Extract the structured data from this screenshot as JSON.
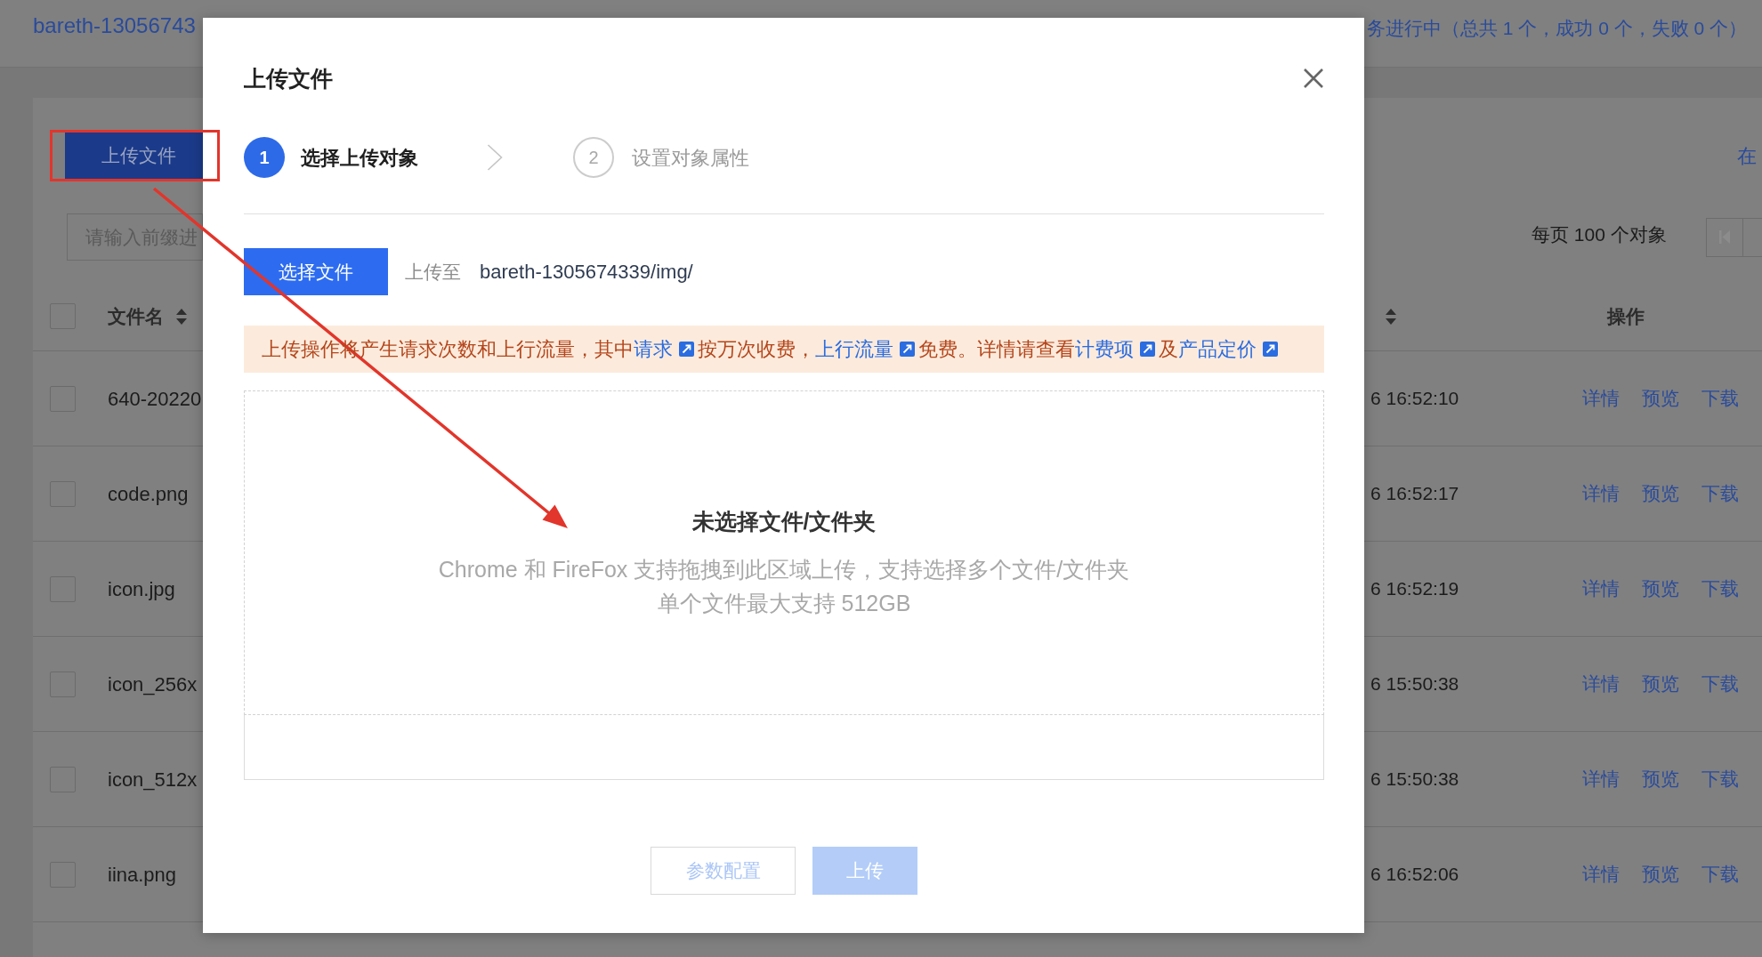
{
  "bucket_page": {
    "title": "bareth-13056743",
    "task_status": "务进行中（总共 1 个，成功 0 个，失败 0 个）",
    "upload_button": "上传文件",
    "link": "在",
    "search": {
      "placeholder": "请输入前缀进"
    },
    "page_size": "每页 100 个对象",
    "table": {
      "select_all": {
        "checked": false
      },
      "columns": [
        {
          "label": "文件名",
          "sortable": true
        },
        {
          "sortable": true
        },
        {
          "label": "操作",
          "sortable": false
        }
      ],
      "rows": [
        {
          "checked": false,
          "name": "640-20220",
          "modified": "6 16:52:10",
          "actions": [
            "详情",
            "预览",
            "下载"
          ]
        },
        {
          "checked": false,
          "name": "code.png",
          "modified": "6 16:52:17",
          "actions": [
            "详情",
            "预览",
            "下载"
          ]
        },
        {
          "checked": false,
          "name": "icon.jpg",
          "modified": "6 16:52:19",
          "actions": [
            "详情",
            "预览",
            "下载"
          ]
        },
        {
          "checked": false,
          "name": "icon_256x",
          "modified": "6 15:50:38",
          "actions": [
            "详情",
            "预览",
            "下载"
          ]
        },
        {
          "checked": false,
          "name": "icon_512x",
          "modified": "6 15:50:38",
          "actions": [
            "详情",
            "预览",
            "下载"
          ]
        },
        {
          "checked": false,
          "name": "iina.png",
          "modified": "6 16:52:06",
          "actions": [
            "详情",
            "预览",
            "下载"
          ]
        }
      ]
    }
  },
  "upload_dialog": {
    "title": "上传文件",
    "steps": [
      {
        "number": "1",
        "label": "选择上传对象",
        "active": true
      },
      {
        "number": "2",
        "label": "设置对象属性",
        "active": false
      }
    ],
    "select_button": "选择文件",
    "destination_label": "上传至",
    "destination_path": "bareth-1305674339/img/",
    "notice": [
      {
        "kind": "text",
        "text": "上传操作将产生请求次数和上行流量，其中"
      },
      {
        "kind": "link",
        "text": "请求"
      },
      {
        "kind": "text",
        "text": "按万次收费，"
      },
      {
        "kind": "link",
        "text": "上行流量"
      },
      {
        "kind": "text",
        "text": "免费。详情请查看"
      },
      {
        "kind": "link",
        "text": "计费项"
      },
      {
        "kind": "text",
        "text": "及"
      },
      {
        "kind": "link",
        "text": "产品定价"
      }
    ],
    "drop_zone": {
      "title": "未选择文件/文件夹",
      "lines": [
        "Chrome 和 FireFox 支持拖拽到此区域上传，支持选择多个文件/文件夹",
        "单个文件最大支持 512GB"
      ]
    },
    "buttons": [
      {
        "label": "参数配置",
        "kind": "secondary",
        "disabled": true
      },
      {
        "label": "上传",
        "kind": "primary",
        "disabled": true
      }
    ]
  }
}
